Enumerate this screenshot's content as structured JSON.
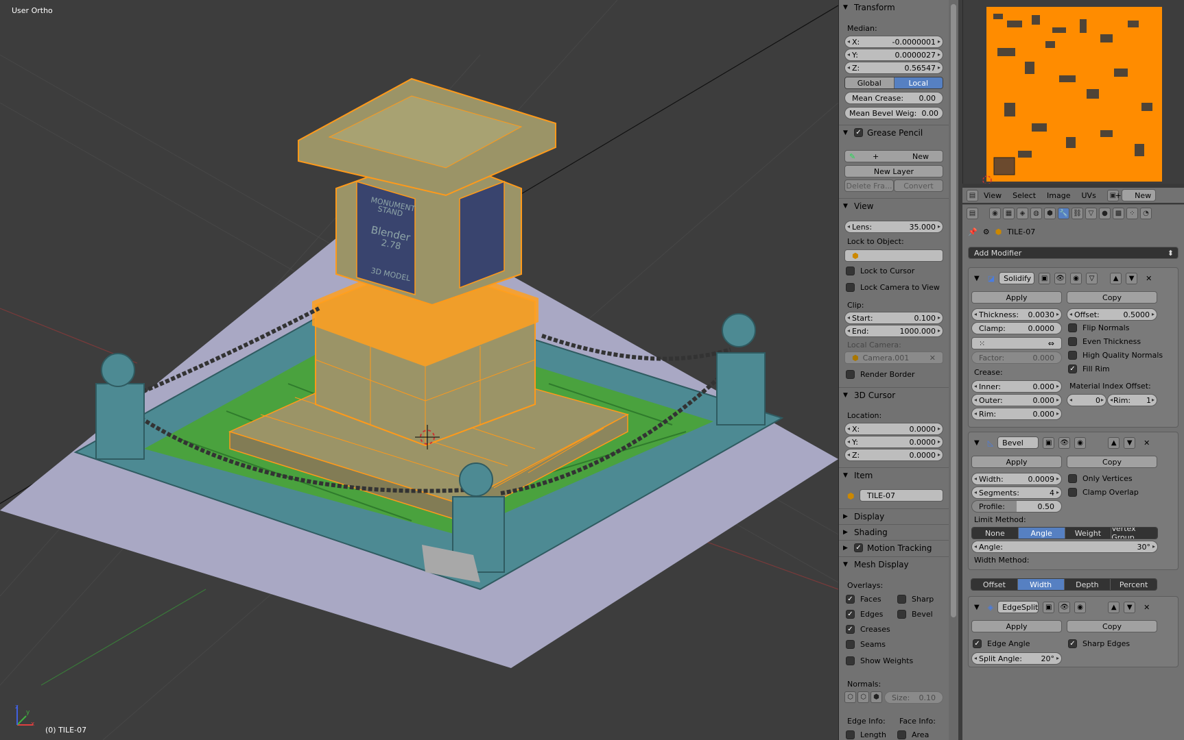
{
  "viewport": {
    "view_label": "User Ortho",
    "object_label": "(0) TILE-07",
    "sign": {
      "line1": "MONUMENT",
      "line2": "STAND",
      "line3": "Blender",
      "line4": "2.78",
      "line5": "3D MODEL"
    },
    "axis": {
      "x": "x",
      "y": "y",
      "z": "z"
    }
  },
  "npanel": {
    "transform": {
      "title": "Transform",
      "median_label": "Median:",
      "x": {
        "k": "X:",
        "v": "-0.0000001"
      },
      "y": {
        "k": "Y:",
        "v": "0.0000027"
      },
      "z": {
        "k": "Z:",
        "v": "0.56547"
      },
      "global": "Global",
      "local": "Local",
      "mean_crease": {
        "k": "Mean Crease:",
        "v": "0.00"
      },
      "mean_bevel": {
        "k": "Mean Bevel Weig:",
        "v": "0.00"
      }
    },
    "grease_pencil": {
      "title": "Grease Pencil",
      "new": "New",
      "new_layer": "New Layer",
      "delete_frame": "Delete Fra...",
      "convert": "Convert"
    },
    "view": {
      "title": "View",
      "lens": {
        "k": "Lens:",
        "v": "35.000"
      },
      "lock_to_object": "Lock to Object:",
      "lock_to_cursor": "Lock to Cursor",
      "lock_camera": "Lock Camera to View",
      "clip": "Clip:",
      "start": {
        "k": "Start:",
        "v": "0.100"
      },
      "end": {
        "k": "End:",
        "v": "1000.000"
      },
      "local_camera": "Local Camera:",
      "camera": "Camera.001",
      "render_border": "Render Border"
    },
    "cursor": {
      "title": "3D Cursor",
      "location": "Location:",
      "x": {
        "k": "X:",
        "v": "0.0000"
      },
      "y": {
        "k": "Y:",
        "v": "0.0000"
      },
      "z": {
        "k": "Z:",
        "v": "0.0000"
      }
    },
    "item": {
      "title": "Item",
      "name": "TILE-07"
    },
    "display": "Display",
    "shading": "Shading",
    "motion_tracking": "Motion Tracking",
    "mesh_display": {
      "title": "Mesh Display",
      "overlays": "Overlays:",
      "faces": "Faces",
      "sharp": "Sharp",
      "edges": "Edges",
      "bevel": "Bevel",
      "creases": "Creases",
      "seams": "Seams",
      "show_weights": "Show Weights",
      "normals": "Normals:",
      "size": {
        "k": "Size:",
        "v": "0.10"
      },
      "edge_info": "Edge Info:",
      "face_info": "Face Info:",
      "length": "Length",
      "area": "Area"
    }
  },
  "uv_header": {
    "view": "View",
    "select": "Select",
    "image": "Image",
    "uvs": "UVs",
    "new": "New"
  },
  "properties": {
    "object_name": "TILE-07",
    "add_modifier": "Add Modifier",
    "solidify": {
      "name": "Solidify",
      "apply": "Apply",
      "copy": "Copy",
      "thickness": {
        "k": "Thickness:",
        "v": "0.0030"
      },
      "offset": {
        "k": "Offset:",
        "v": "0.5000"
      },
      "clamp": {
        "k": "Clamp:",
        "v": "0.0000"
      },
      "flip_normals": "Flip Normals",
      "even_thickness": "Even Thickness",
      "high_quality": "High Quality Normals",
      "factor": {
        "k": "Factor:",
        "v": "0.000"
      },
      "fill_rim": "Fill Rim",
      "crease": "Crease:",
      "material_index": "Material Index Offset:",
      "inner": {
        "k": "Inner:",
        "v": "0.000"
      },
      "mat_offset": "0",
      "rim_k": "Rim:",
      "rim_v": "1",
      "outer": {
        "k": "Outer:",
        "v": "0.000"
      },
      "rim": {
        "k": "Rim:",
        "v": "0.000"
      }
    },
    "bevel": {
      "name": "Bevel",
      "apply": "Apply",
      "copy": "Copy",
      "width": {
        "k": "Width:",
        "v": "0.0009"
      },
      "only_vertices": "Only Vertices",
      "segments": {
        "k": "Segments:",
        "v": "4"
      },
      "clamp_overlap": "Clamp Overlap",
      "profile": {
        "k": "Profile:",
        "v": "0.50"
      },
      "limit_method": "Limit Method:",
      "limit_options": [
        "None",
        "Angle",
        "Weight",
        "Vertex Group"
      ],
      "angle": {
        "k": "Angle:",
        "v": "30°"
      },
      "width_method": "Width Method:",
      "width_options": [
        "Offset",
        "Width",
        "Depth",
        "Percent"
      ]
    },
    "edgesplit": {
      "name": "EdgeSplit",
      "apply": "Apply",
      "copy": "Copy",
      "edge_angle": "Edge Angle",
      "sharp_edges": "Sharp Edges",
      "split_angle": {
        "k": "Split Angle:",
        "v": "20°"
      }
    }
  },
  "colors": {
    "selection": "#ff9a1a",
    "active_tab": "#5680c2",
    "viewport_bg": "#3d3d3d",
    "panel_bg": "#727272"
  }
}
